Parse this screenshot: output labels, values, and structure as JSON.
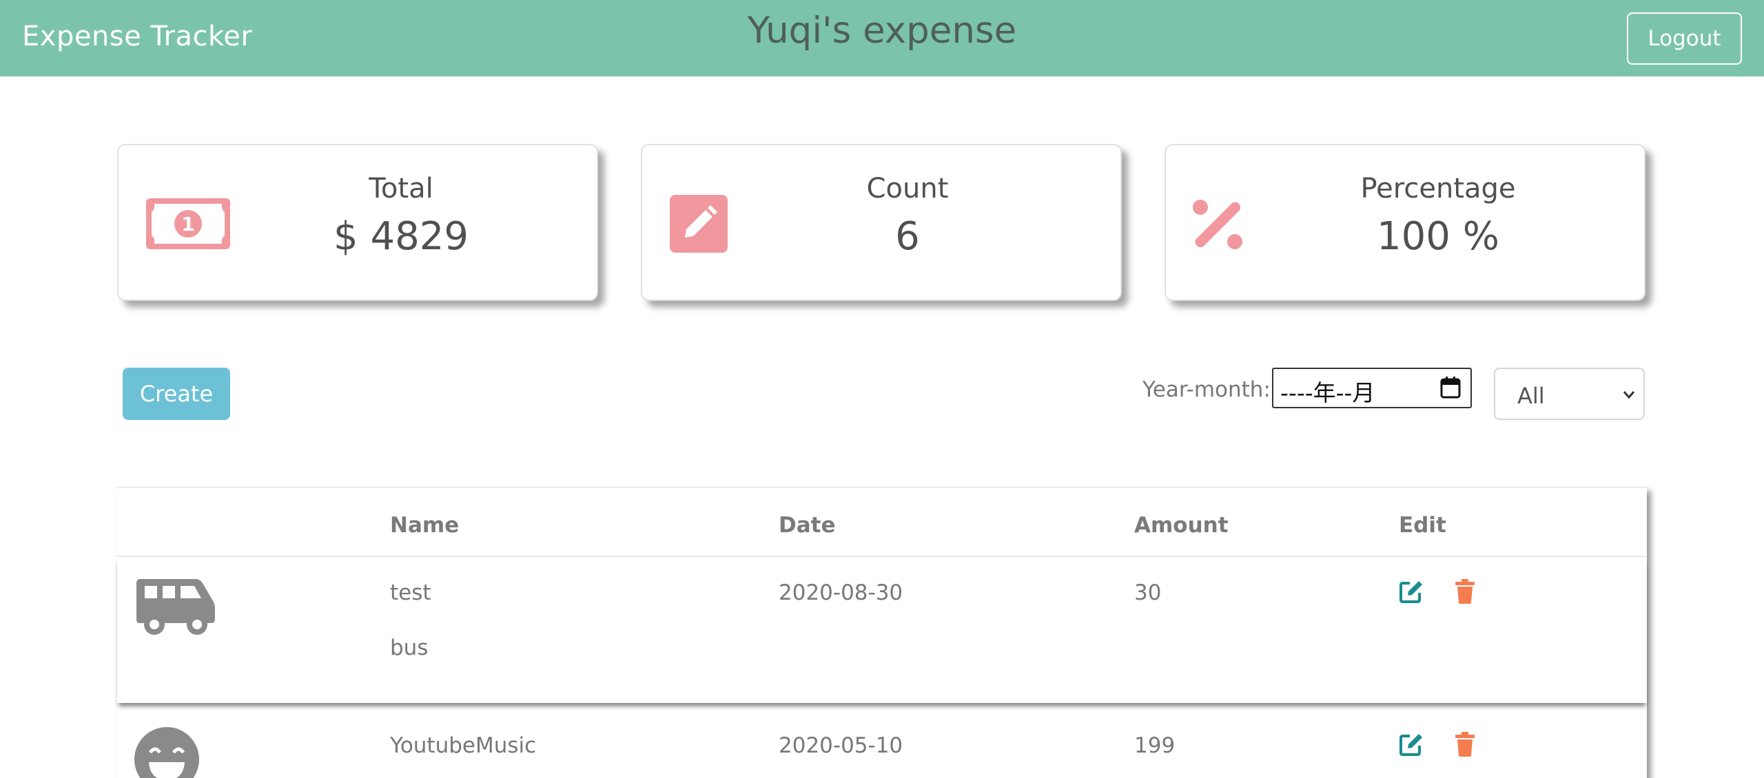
{
  "header": {
    "brand": "Expense Tracker",
    "title": "Yuqi's expense",
    "logout_label": "Logout",
    "bg_color": "#7bc4ab"
  },
  "stats": [
    {
      "label": "Total",
      "value": "$ 4829",
      "icon": "money-bill-icon"
    },
    {
      "label": "Count",
      "value": "6",
      "icon": "edit-square-icon"
    },
    {
      "label": "Percentage",
      "value": "100 %",
      "icon": "percent-icon"
    }
  ],
  "controls": {
    "create_label": "Create",
    "year_month_label": "Year-month:",
    "year_month_value": "----年--月",
    "filter_selected": "All"
  },
  "table": {
    "headers": [
      "Name",
      "Date",
      "Amount",
      "Edit"
    ],
    "rows": [
      {
        "icon": "bus-icon",
        "name": "test",
        "note": "bus",
        "date": "2020-08-30",
        "amount": "30"
      },
      {
        "icon": "smile-icon",
        "name": "YoutubeMusic",
        "date": "2020-05-10",
        "amount": "199"
      }
    ]
  },
  "colors": {
    "accent_pink": "#f0989e",
    "create_blue": "#6cc1d6",
    "edit_teal": "#1a8c8c",
    "delete_orange": "#f47c4f"
  }
}
